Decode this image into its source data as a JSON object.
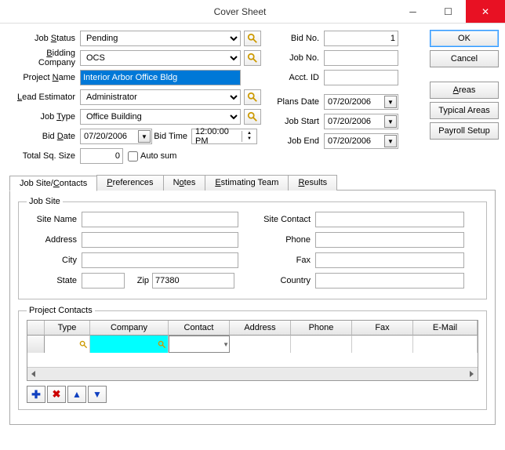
{
  "window": {
    "title": "Cover Sheet",
    "minimize": "–",
    "maximize": "□",
    "close": "✕"
  },
  "labels": {
    "job_status": "Job Status",
    "bidding_company": "Bidding Company",
    "project_name": "Project Name",
    "lead_estimator": "Lead Estimator",
    "job_type": "Job Type",
    "bid_date": "Bid Date",
    "bid_time": "Bid Time",
    "total_sq_size": "Total Sq. Size",
    "auto_sum": "Auto sum",
    "bid_no": "Bid No.",
    "job_no": "Job No.",
    "acct_id": "Acct. ID",
    "plans_date": "Plans Date",
    "job_start": "Job Start",
    "job_end": "Job End"
  },
  "fields": {
    "job_status": "Pending",
    "bidding_company": "OCS",
    "project_name": "Interior Arbor Office Bldg",
    "lead_estimator": "Administrator",
    "job_type": "Office Building",
    "bid_date": "07/20/2006",
    "bid_time": "12:00:00 PM",
    "total_sq_size": "0",
    "bid_no": "1",
    "job_no": "",
    "acct_id": "",
    "plans_date": "07/20/2006",
    "job_start": "07/20/2006",
    "job_end": "07/20/2006"
  },
  "buttons": {
    "ok": "OK",
    "cancel": "Cancel",
    "areas": "Areas",
    "typical_areas": "Typical Areas",
    "payroll_setup": "Payroll Setup"
  },
  "tabs": {
    "job_site": "Job Site/Contacts",
    "preferences": "Preferences",
    "notes": "Notes",
    "estimating_team": "Estimating Team",
    "results": "Results"
  },
  "jobsite": {
    "legend": "Job Site",
    "site_name_lbl": "Site Name",
    "address_lbl": "Address",
    "city_lbl": "City",
    "state_lbl": "State",
    "zip_lbl": "Zip",
    "site_contact_lbl": "Site Contact",
    "phone_lbl": "Phone",
    "fax_lbl": "Fax",
    "country_lbl": "Country",
    "site_name": "",
    "address": "",
    "city": "",
    "state": "",
    "zip": "77380",
    "site_contact": "",
    "phone": "",
    "fax": "",
    "country": ""
  },
  "contacts": {
    "legend": "Project Contacts",
    "headers": [
      "Type",
      "Company",
      "Contact",
      "Address",
      "Phone",
      "Fax",
      "E-Mail"
    ]
  },
  "icons": {
    "add": "add-icon",
    "delete": "delete-icon",
    "up": "up-icon",
    "down": "down-icon"
  }
}
